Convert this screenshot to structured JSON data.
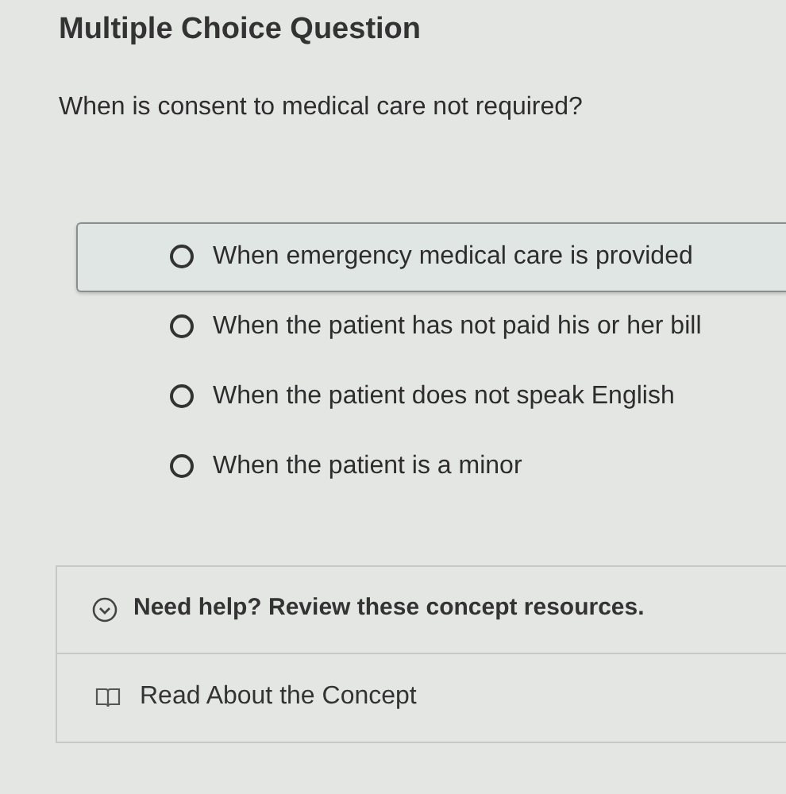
{
  "title": "Multiple Choice Question",
  "question": "When is consent to medical care not required?",
  "options": [
    {
      "label": "When emergency medical care is provided",
      "focused": true
    },
    {
      "label": "When the patient has not paid his or her bill",
      "focused": false
    },
    {
      "label": "When the patient does not speak English",
      "focused": false
    },
    {
      "label": "When the patient is a minor",
      "focused": false
    }
  ],
  "help": {
    "heading": "Need help? Review these concept resources.",
    "expanded": true,
    "links": [
      "Read About the Concept"
    ]
  }
}
